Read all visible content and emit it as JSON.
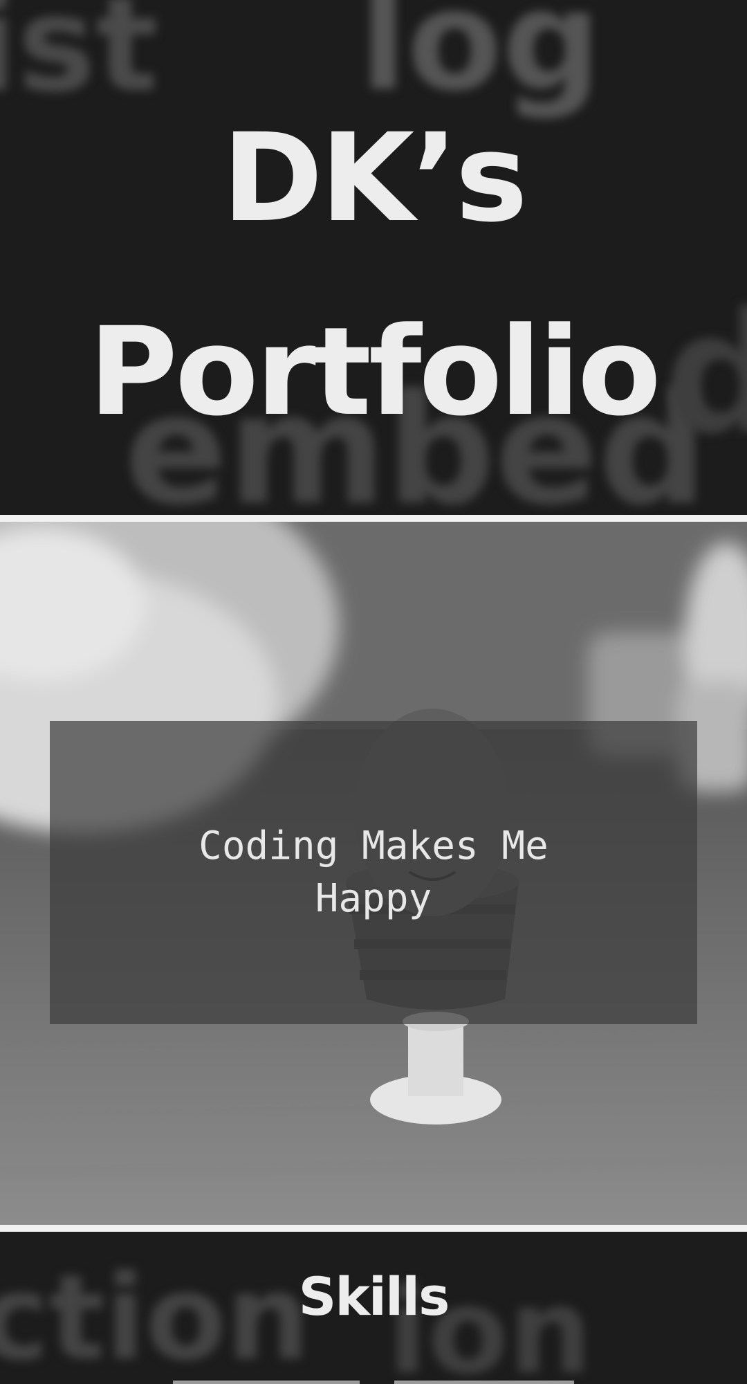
{
  "hero": {
    "title_line1": "DK’s",
    "title_line2": "Portfolio"
  },
  "intro": {
    "quote": "Coding Makes Me Happy"
  },
  "skills": {
    "heading": "Skills"
  }
}
